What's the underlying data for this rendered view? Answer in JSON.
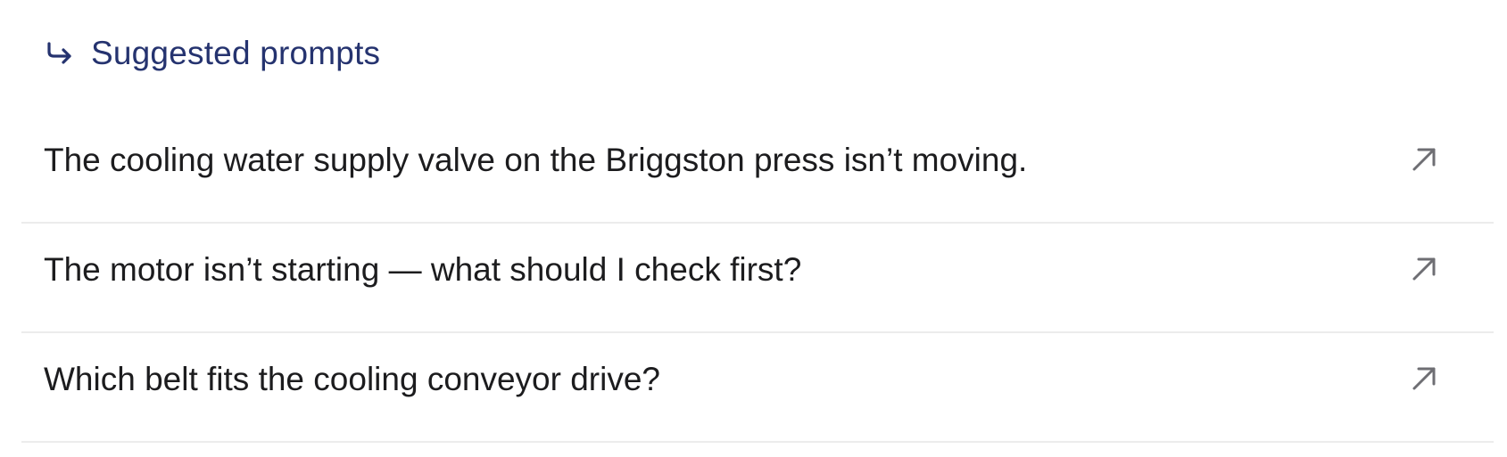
{
  "header": {
    "icon": "reply-arrow-icon",
    "title": "Suggested prompts",
    "accent_color": "#25336f"
  },
  "prompts": [
    {
      "text": "The cooling water supply valve on the Briggston press isn’t moving.",
      "icon": "arrow-up-right-icon"
    },
    {
      "text": "The motor isn’t starting — what should I check first?",
      "icon": "arrow-up-right-icon"
    },
    {
      "text": "Which belt fits the cooling conveyor drive?",
      "icon": "arrow-up-right-icon"
    }
  ]
}
